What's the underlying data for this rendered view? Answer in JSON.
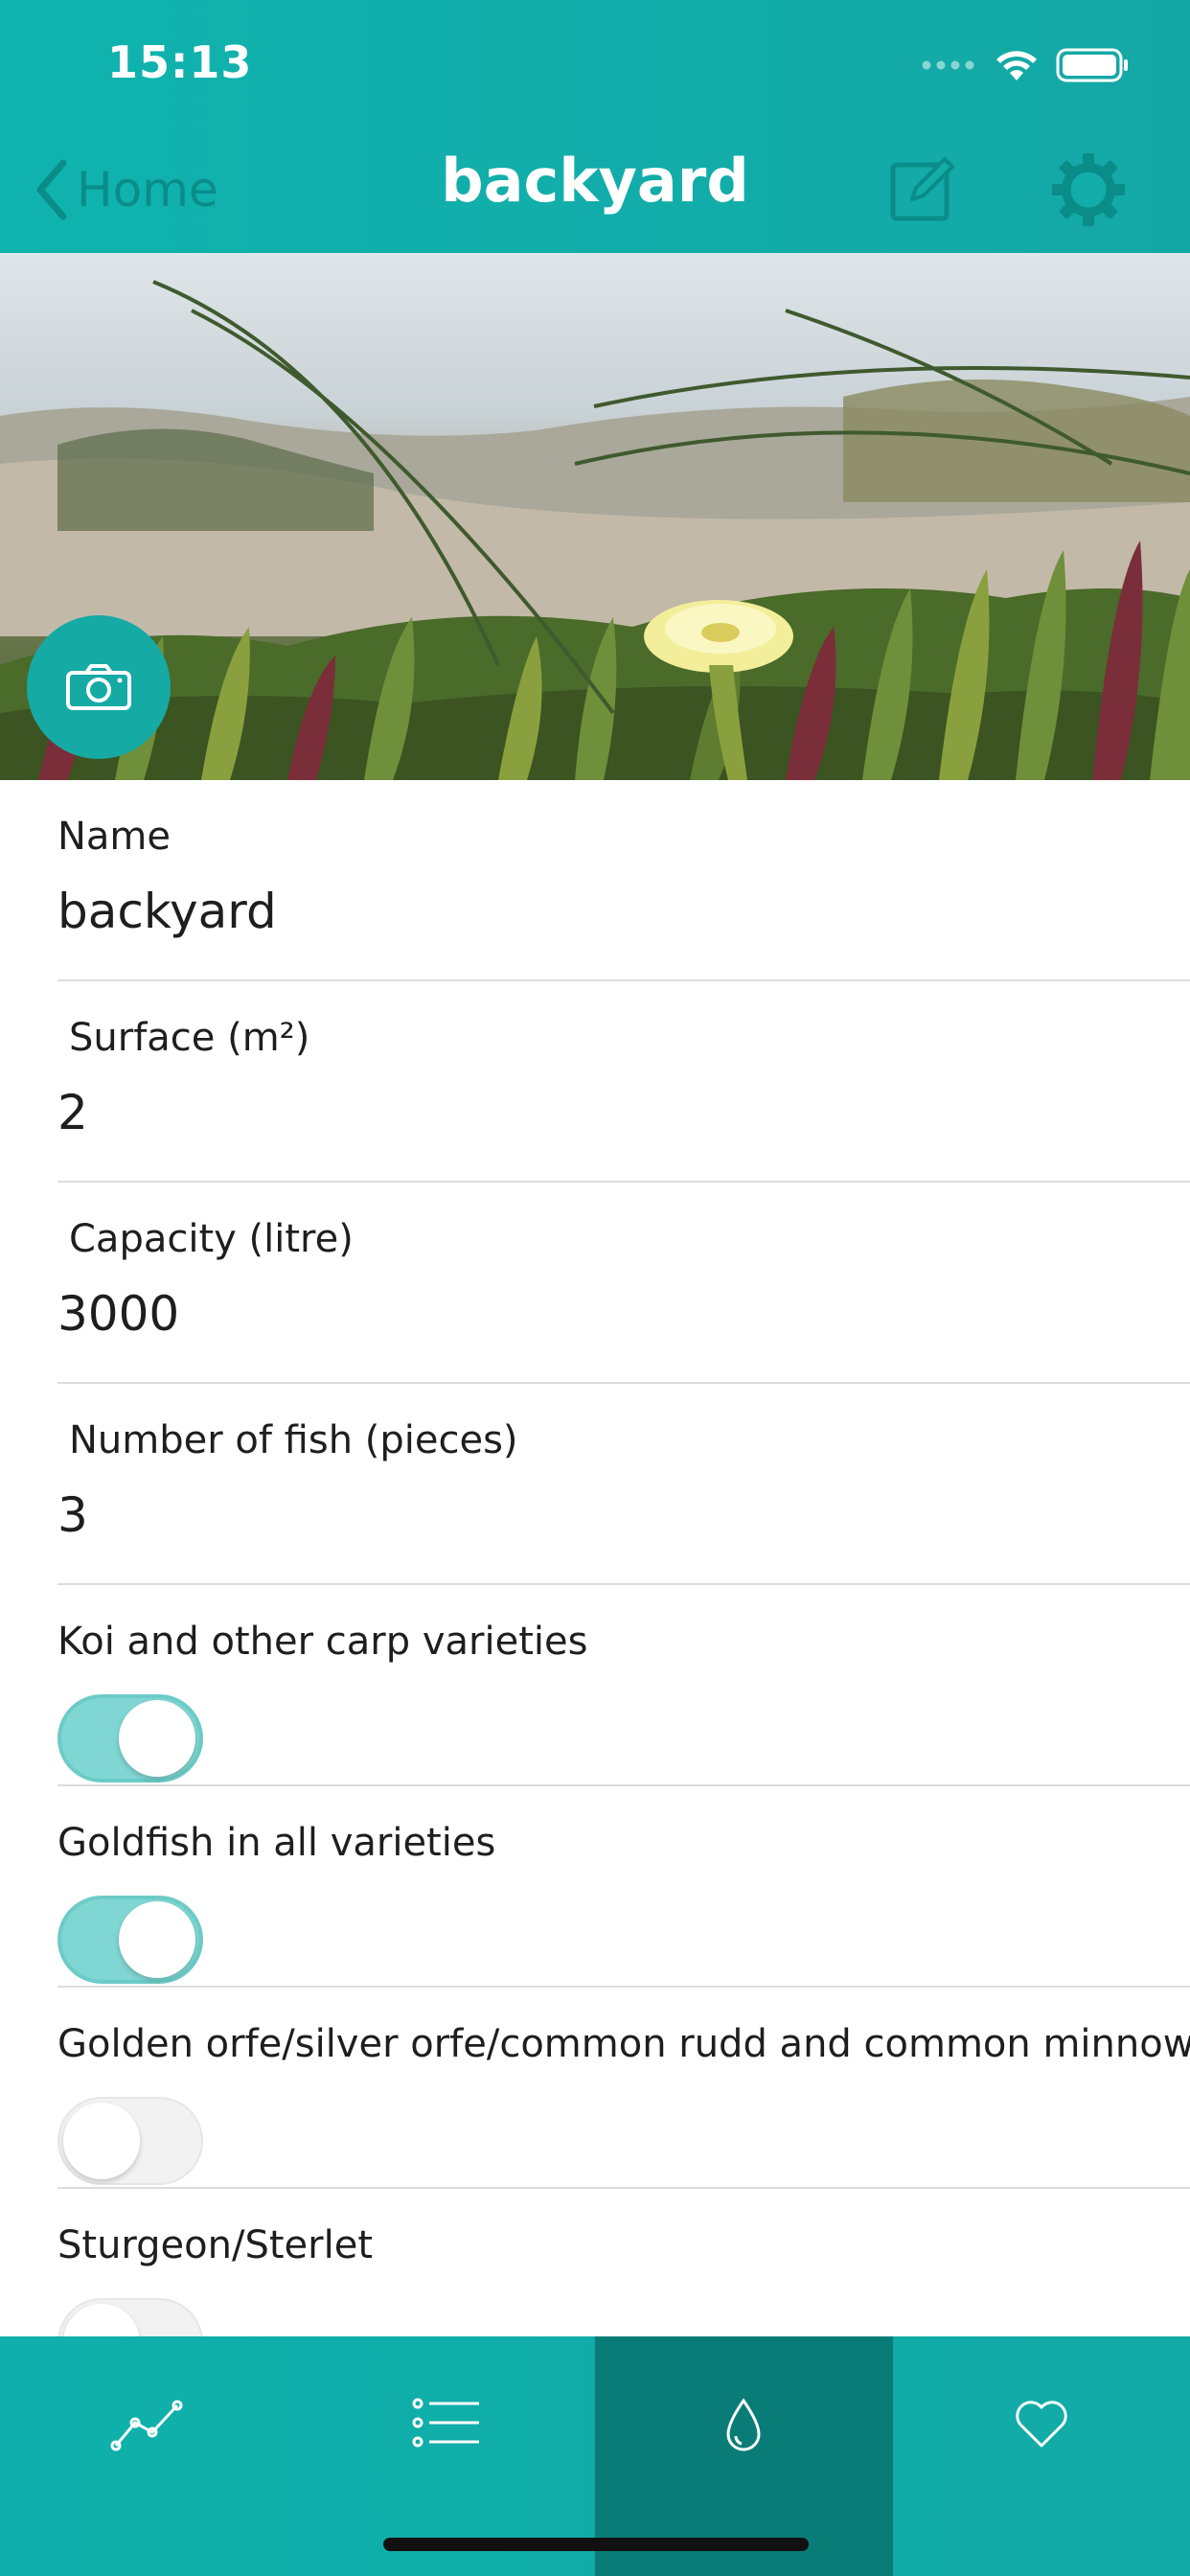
{
  "status_bar": {
    "time": "15:13"
  },
  "nav": {
    "back_label": "Home",
    "title": "backyard"
  },
  "form": {
    "name_label": "Name",
    "name_value": "backyard",
    "surface_label": "Surface (m²)",
    "surface_value": "2",
    "capacity_label": "Capacity (litre)",
    "capacity_value": "3000",
    "fish_label": "Number of fish (pieces)",
    "fish_value": "3",
    "toggles": [
      {
        "label": "Koi and other carp varieties",
        "on": true
      },
      {
        "label": "Goldfish in all varieties",
        "on": true
      },
      {
        "label": "Golden orfe/silver orfe/common rudd and common minnow",
        "on": false
      },
      {
        "label": "Sturgeon/Sterlet",
        "on": false
      }
    ]
  },
  "tabs": [
    {
      "icon": "chart-line-icon",
      "active": false
    },
    {
      "icon": "list-icon",
      "active": false
    },
    {
      "icon": "water-drop-icon",
      "active": true
    },
    {
      "icon": "heart-icon",
      "active": false
    }
  ],
  "colors": {
    "accent": "#12aca9",
    "active_tab": "#0a7c78",
    "toggle_on": "#80d6d3"
  }
}
